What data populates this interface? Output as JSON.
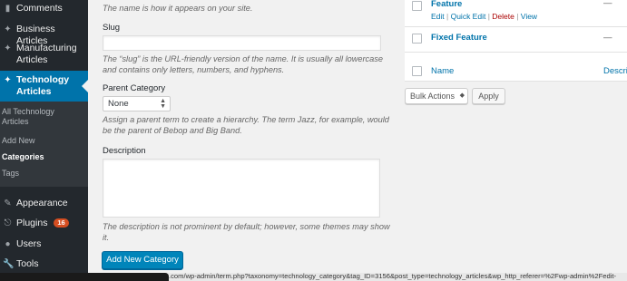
{
  "sidebar": {
    "comments": "Comments",
    "business_articles": "Business Articles",
    "manufacturing_articles_1": "Manufacturing",
    "manufacturing_articles_2": "Articles",
    "technology_articles_1": "Technology",
    "technology_articles_2": "Articles",
    "submenu": {
      "all_1": "All Technology",
      "all_2": "Articles",
      "add_new": "Add New",
      "categories": "Categories",
      "tags": "Tags"
    },
    "appearance": "Appearance",
    "plugins": "Plugins",
    "plugins_badge": "16",
    "users": "Users",
    "tools": "Tools"
  },
  "form": {
    "name_help": "The name is how it appears on your site.",
    "slug_label": "Slug",
    "slug_value": "",
    "slug_help_1": "The “slug” is the URL-friendly version of the name. It is usually all lowercase",
    "slug_help_2": "and contains only letters, numbers, and hyphens.",
    "parent_label": "Parent Category",
    "parent_selected": "None",
    "parent_help_1": "Assign a parent term to create a hierarchy. The term Jazz, for example, would",
    "parent_help_2": "be the parent of Bebop and Big Band.",
    "description_label": "Description",
    "description_value": "",
    "description_help_1": "The description is not prominent by default; however, some themes may show",
    "description_help_2": "it.",
    "submit_label": "Add New Category"
  },
  "table": {
    "rows": [
      {
        "title": "Feature",
        "actions": {
          "edit": "Edit",
          "quick_edit": "Quick Edit",
          "delete": "Delete",
          "view": "View"
        },
        "description": "—"
      },
      {
        "title": "Fixed Feature",
        "description": "—"
      }
    ],
    "footer_columns": {
      "name": "Name",
      "description": "Descri"
    },
    "bulk_actions_label": "Bulk Actions",
    "apply_label": "Apply"
  },
  "status_bar": {
    "url": ".com/wp-admin/term.php?taxonomy=technology_category&tag_ID=3156&post_type=technology_articles&wp_http_referer=%2Fwp-admin%2Fedit-"
  },
  "colors": {
    "sidebar_bg": "#23282d",
    "active_menu": "#0073aa",
    "link": "#0073aa",
    "primary_button": "#0085ba",
    "delete_link": "#a00"
  }
}
